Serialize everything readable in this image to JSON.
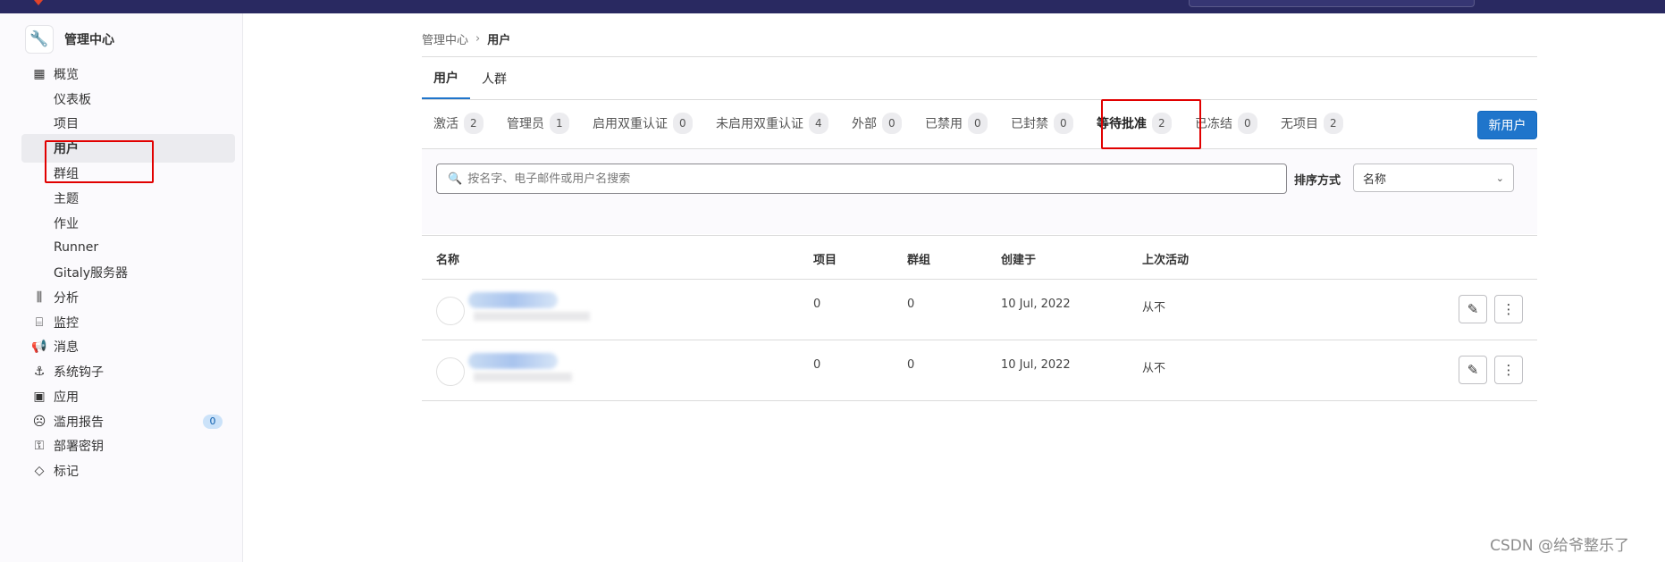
{
  "sidebar": {
    "title": "管理中心",
    "items": [
      {
        "label": "概览",
        "icon": "overview-icon",
        "glyph": "▦"
      },
      {
        "label": "仪表板"
      },
      {
        "label": "项目"
      },
      {
        "label": "用户"
      },
      {
        "label": "群组"
      },
      {
        "label": "主题"
      },
      {
        "label": "作业"
      },
      {
        "label": "Runner"
      },
      {
        "label": "Gitaly服务器"
      },
      {
        "label": "分析",
        "icon": "analytics-icon",
        "glyph": "⫼"
      },
      {
        "label": "监控",
        "icon": "monitor-icon",
        "glyph": "⌸"
      },
      {
        "label": "消息",
        "icon": "messages-icon",
        "glyph": "📢"
      },
      {
        "label": "系统钩子",
        "icon": "hook-icon",
        "glyph": "⚓"
      },
      {
        "label": "应用",
        "icon": "applications-icon",
        "glyph": "▣"
      },
      {
        "label": "滥用报告",
        "icon": "abuse-icon",
        "glyph": "☹",
        "badge": "0"
      },
      {
        "label": "部署密钥",
        "icon": "key-icon",
        "glyph": "⚿"
      },
      {
        "label": "标记",
        "icon": "label-icon",
        "glyph": "◇"
      }
    ]
  },
  "breadcrumb": {
    "root": "管理中心",
    "current": "用户"
  },
  "tabs_primary": [
    "用户",
    "人群"
  ],
  "tabs_status": [
    {
      "label": "激活",
      "count": "2"
    },
    {
      "label": "管理员",
      "count": "1"
    },
    {
      "label": "启用双重认证",
      "count": "0"
    },
    {
      "label": "未启用双重认证",
      "count": "4"
    },
    {
      "label": "外部",
      "count": "0"
    },
    {
      "label": "已禁用",
      "count": "0"
    },
    {
      "label": "已封禁",
      "count": "0"
    },
    {
      "label": "等待批准",
      "count": "2"
    },
    {
      "label": "已冻结",
      "count": "0"
    },
    {
      "label": "无项目",
      "count": "2"
    }
  ],
  "new_user_label": "新用户",
  "search": {
    "placeholder": "按名字、电子邮件或用户名搜索",
    "value": ""
  },
  "sort": {
    "label": "排序方式",
    "selected": "名称"
  },
  "table": {
    "headers": [
      "名称",
      "项目",
      "群组",
      "创建于",
      "上次活动"
    ],
    "rows": [
      {
        "projects": "0",
        "groups": "0",
        "created": "10 Jul, 2022",
        "last_activity": "从不"
      },
      {
        "projects": "0",
        "groups": "0",
        "created": "10 Jul, 2022",
        "last_activity": "从不"
      }
    ]
  },
  "watermark": "CSDN @给爷整乐了",
  "colors": {
    "accent": "#1f75cb",
    "highlight": "#e10000",
    "topbar": "#292961"
  }
}
